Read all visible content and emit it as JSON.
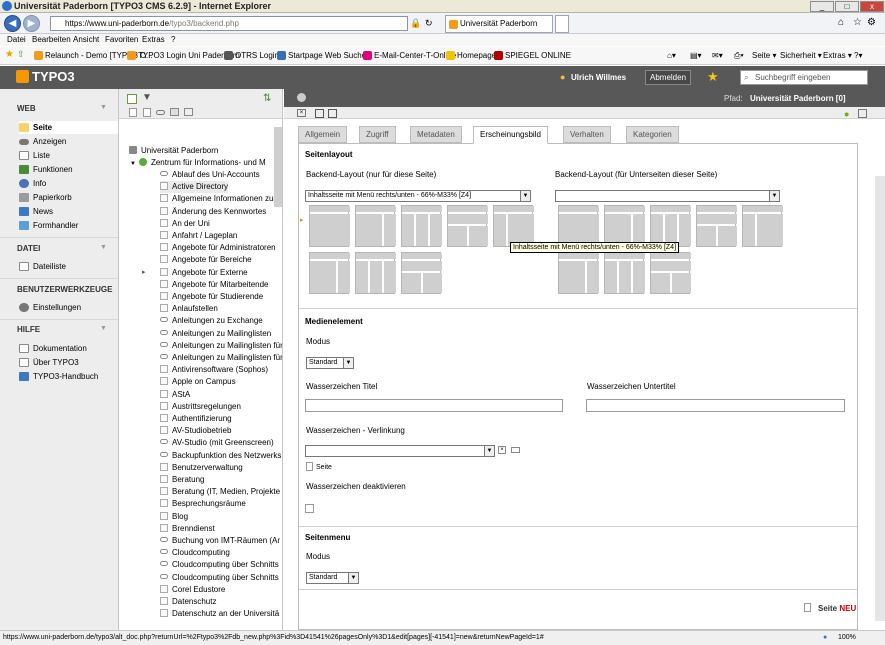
{
  "window": {
    "title": "Universität Paderborn [TYPO3 CMS 6.2.9] - Internet Explorer"
  },
  "browser": {
    "address": "https://www.uni-paderborn.de/typo3/backend.php",
    "address_host": "https://www.uni-paderborn.de",
    "address_path": "/typo3/backend.php",
    "tab_label": "Universität Paderborn [TYPO ...",
    "menu": [
      "Datei",
      "Bearbeiten",
      "Ansicht",
      "Favoriten",
      "Extras",
      "?"
    ],
    "favorites": [
      {
        "label": "Relaunch - Demo [TYPO3 C...",
        "color": "#f29b1d"
      },
      {
        "label": "TYPO3 Login Uni Paderborn",
        "color": "#f29b1d"
      },
      {
        "label": "OTRS  Login",
        "color": "#555555"
      },
      {
        "label": "Startpage Web Suchen",
        "color": "#3a6db8"
      },
      {
        "label": "E-Mail-Center-T-Online",
        "color": "#e2007a"
      },
      {
        "label": "Homepage",
        "color": "#f2c300"
      },
      {
        "label": "SPIEGEL ONLINE",
        "color": "#b00000"
      }
    ],
    "tools": [
      "Seite ▾",
      "Sicherheit ▾",
      "Extras ▾"
    ],
    "status_url": "https://www.uni-paderborn.de/typo3/alt_doc.php?returnUrl=%2Ftypo3%2Fdb_new.php%3Fid%3D41541%26pagesOnly%3D1&edit[pages][-41541]=new&returnNewPageId=1#",
    "zoom": "100%"
  },
  "typo3": {
    "logo": "TYPO3",
    "user": "Ulrich Willmes",
    "logout": "Abmelden",
    "search_placeholder": "Suchbegriff eingeben",
    "path_label": "Pfad:",
    "path_value": "Universität Paderborn [0]"
  },
  "modules": {
    "web": {
      "title": "WEB",
      "items": [
        {
          "label": "Seite",
          "icon": "page-edit-icon"
        },
        {
          "label": "Anzeigen",
          "icon": "eye-icon"
        },
        {
          "label": "Liste",
          "icon": "list-icon"
        },
        {
          "label": "Funktionen",
          "icon": "functions-icon"
        },
        {
          "label": "Info",
          "icon": "info-icon"
        },
        {
          "label": "Papierkorb",
          "icon": "trash-icon"
        },
        {
          "label": "News",
          "icon": "news-icon"
        },
        {
          "label": "Formhandler",
          "icon": "form-icon"
        }
      ]
    },
    "datei": {
      "title": "DATEI",
      "items": [
        {
          "label": "Dateiliste",
          "icon": "folder-icon"
        }
      ]
    },
    "tools": {
      "title": "BENUTZERWERKZEUGE",
      "items": [
        {
          "label": "Einstellungen",
          "icon": "user-settings-icon"
        }
      ]
    },
    "help": {
      "title": "HILFE",
      "items": [
        {
          "label": "Dokumentation",
          "icon": "docs-icon"
        },
        {
          "label": "Über TYPO3",
          "icon": "about-icon"
        },
        {
          "label": "TYPO3-Handbuch",
          "icon": "manual-icon"
        }
      ]
    }
  },
  "tree": {
    "root": "Universität Paderborn",
    "node": "Zentrum für Informations- und M",
    "items": [
      "Ablauf des Uni-Accounts",
      "Active Directory",
      "Allgemeine Informationen zum",
      "Änderung des Kennwortes",
      "An der Uni",
      "Anfahrt / Lageplan",
      "Angebote für Administratoren",
      "Angebote für Bereiche",
      "Angebote für Externe",
      "Angebote für Mitarbeitende",
      "Angebote für Studierende",
      "Anlaufstellen",
      "Anleitungen zu Exchange",
      "Anleitungen zu Mailinglisten",
      "Anleitungen zu Mailinglisten für",
      "Anleitungen zu Mailinglisten für",
      "Antivirensoftware (Sophos)",
      "Apple on Campus",
      "AStA",
      "Austrittsregelungen",
      "Authentifizierung",
      "AV-Studiobetrieb",
      "AV-Studio (mit Greenscreen)",
      "Backupfunktion des Netzwerks",
      "Benutzerverwaltung",
      "Beratung",
      "Beratung (IT, Medien, Projekte",
      "Besprechungsräume",
      "Blog",
      "Brenndienst",
      "Buchung von IMT-Räumen (Ar",
      "Cloudcomputing",
      "Cloudcomputing über Schnitts",
      "Cloudcomputing über Schnitts",
      "Corel Edustore",
      "Datenschutz",
      "Datenschutz an der Universitä"
    ]
  },
  "form": {
    "tabs": [
      "Allgemein",
      "Zugriff",
      "Metadaten",
      "Erscheinungsbild",
      "Verhalten",
      "Kategorien"
    ],
    "active_tab": "Erscheinungsbild",
    "seitenlayout": {
      "title": "Seitenlayout",
      "backend_layout_label": "Backend-Layout (nur für diese Seite)",
      "backend_layout_value": "Inhaltsseite mit Menü rechts/unten - 66%-M33% [Z4]",
      "subpages_label": "Backend-Layout (für Unterseiten dieser Seite)",
      "subpages_value": "",
      "tooltip": "Inhaltsseite mit Menü rechts/unten - 66%-M33% [Z4]"
    },
    "medien": {
      "title": "Medienelement",
      "modus_label": "Modus",
      "modus_value": "Standard",
      "wz_titel_label": "Wasserzeichen Titel",
      "wz_untertitel_label": "Wasserzeichen Untertitel",
      "wz_link_label": "Wasserzeichen - Verlinkung",
      "seite_label": "Seite",
      "wz_deakt_label": "Wasserzeichen deaktivieren"
    },
    "seitenmenu": {
      "title": "Seitenmenu",
      "modus_label": "Modus",
      "modus_value": "Standard"
    },
    "new_page_label": "Seite",
    "new_page_flag": "NEU"
  }
}
